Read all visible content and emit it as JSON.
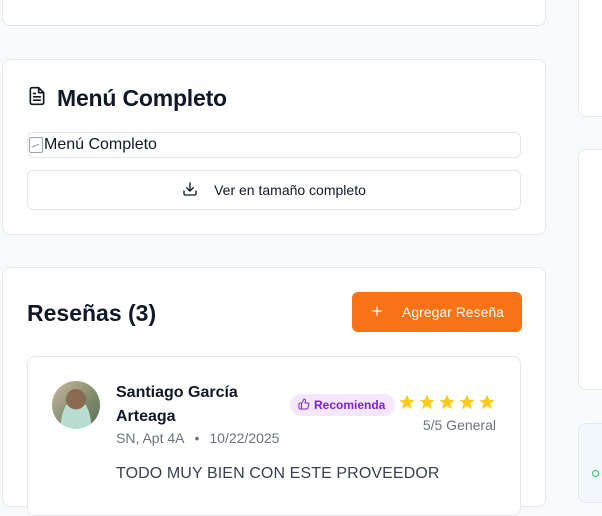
{
  "menu": {
    "title": "Menú Completo",
    "image_alt": "Menú Completo",
    "view_full_label": "Ver en tamaño completo"
  },
  "reviews": {
    "title": "Reseñas (3)",
    "add_label": "Agregar Reseña",
    "items": [
      {
        "name": "Santiago García Arteaga",
        "location": "SN, Apt 4A",
        "separator": "•",
        "date": "10/22/2025",
        "badge": "Recomienda",
        "rating": 5,
        "score_text": "5/5 General",
        "text": "TODO MUY BIEN CON ESTE PROVEEDOR"
      }
    ]
  },
  "colors": {
    "accent": "#f97316",
    "star": "#facc15",
    "badge_bg": "#f3e8ff",
    "badge_text": "#7e22ce"
  },
  "icons": [
    "document-icon",
    "broken-image-icon",
    "download-icon",
    "plus-icon",
    "thumbs-up-icon",
    "star-icon"
  ]
}
